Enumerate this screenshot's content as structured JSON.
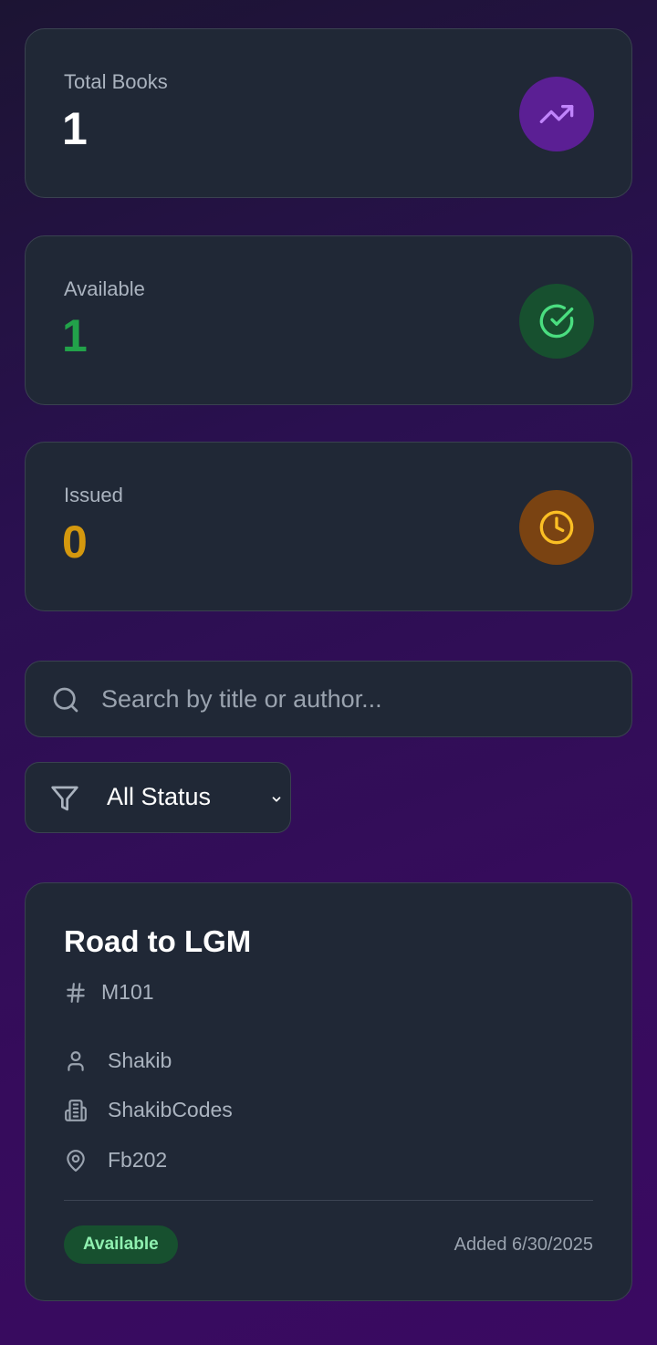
{
  "stats": [
    {
      "label": "Total Books",
      "value": "1",
      "value_color": "#ffffff",
      "icon": "trending-up-icon",
      "icon_bg": "#5b1f94",
      "icon_color": "#c084fc"
    },
    {
      "label": "Available",
      "value": "1",
      "value_color": "#22a24a",
      "icon": "check-circle-icon",
      "icon_bg": "#17502f",
      "icon_color": "#4ade80"
    },
    {
      "label": "Issued",
      "value": "0",
      "value_color": "#d4980e",
      "icon": "clock-icon",
      "icon_bg": "#7a4312",
      "icon_color": "#fbbf24"
    }
  ],
  "search": {
    "placeholder": "Search by title or author..."
  },
  "filter": {
    "selected": "All Status"
  },
  "book": {
    "title": "Road to LGM",
    "id": "M101",
    "author": "Shakib",
    "publisher": "ShakibCodes",
    "location": "Fb202",
    "status": "Available",
    "added": "Added 6/30/2025"
  }
}
